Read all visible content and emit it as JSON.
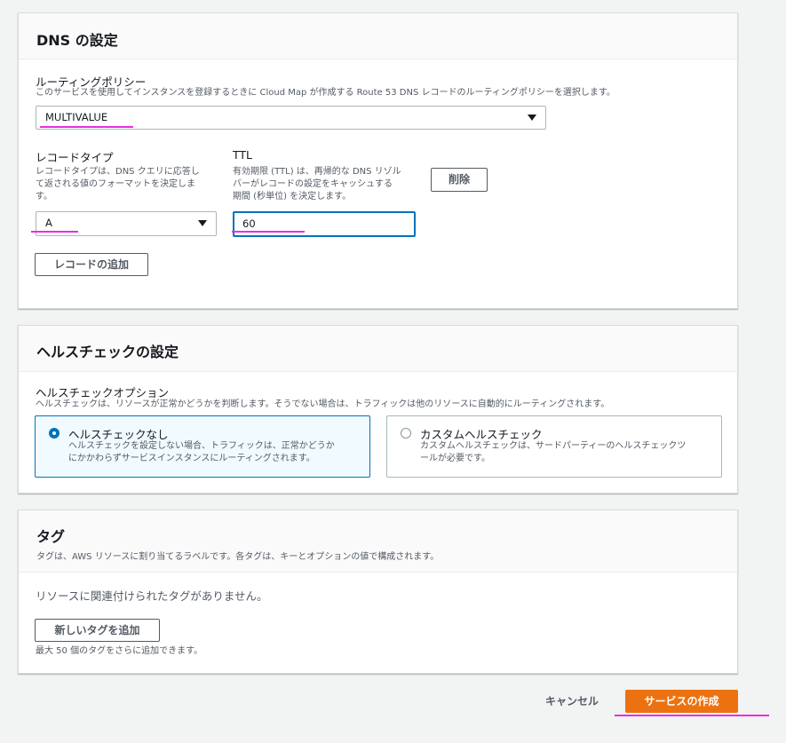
{
  "dns": {
    "title": "DNS の設定",
    "routing_policy": {
      "label": "ルーティングポリシー",
      "description": "このサービスを使用してインスタンスを登録するときに Cloud Map が作成する Route 53 DNS レコードのルーティングポリシーを選択します。",
      "value": "MULTIVALUE"
    },
    "record_type": {
      "label": "レコードタイプ",
      "description_lines": [
        "レコードタイプは、DNS クエリに応答し",
        "て返される値のフォーマットを決定しま",
        "す。"
      ],
      "value": "A"
    },
    "ttl": {
      "label": "TTL",
      "description_lines": [
        "有効期限 (TTL) は、再帰的な DNS リゾル",
        "バーがレコードの設定をキャッシュする",
        "期間 (秒単位) を決定します。"
      ],
      "value": "60"
    },
    "delete_label": "削除",
    "add_record_label": "レコードの追加"
  },
  "health": {
    "title": "ヘルスチェックの設定",
    "option_label": "ヘルスチェックオプション",
    "option_description": "ヘルスチェックは、リソースが正常かどうかを判断します。そうでない場合は、トラフィックは他のリソースに自動的にルーティングされます。",
    "options": [
      {
        "title": "ヘルスチェックなし",
        "desc_lines": [
          "ヘルスチェックを設定しない場合、トラフィックは、正常かどうか",
          "にかかわらずサービスインスタンスにルーティングされます。"
        ],
        "selected": true
      },
      {
        "title": "カスタムヘルスチェック",
        "desc_lines": [
          "カスタムヘルスチェックは、サードパーティーのヘルスチェックツ",
          "ールが必要です。"
        ],
        "selected": false
      }
    ]
  },
  "tags": {
    "title": "タグ",
    "description": "タグは、AWS リソースに割り当てるラベルです。各タグは、キーとオプションの値で構成されます。",
    "empty_text": "リソースに関連付けられたタグがありません。",
    "add_tag_label": "新しいタグを追加",
    "limit_text": "最大 50 個のタグをさらに追加できます。"
  },
  "footer": {
    "cancel_label": "キャンセル",
    "create_label": "サービスの作成"
  },
  "colors": {
    "primary": "#ec7211",
    "focus": "#0073bb",
    "highlight": "#e72fe0"
  }
}
